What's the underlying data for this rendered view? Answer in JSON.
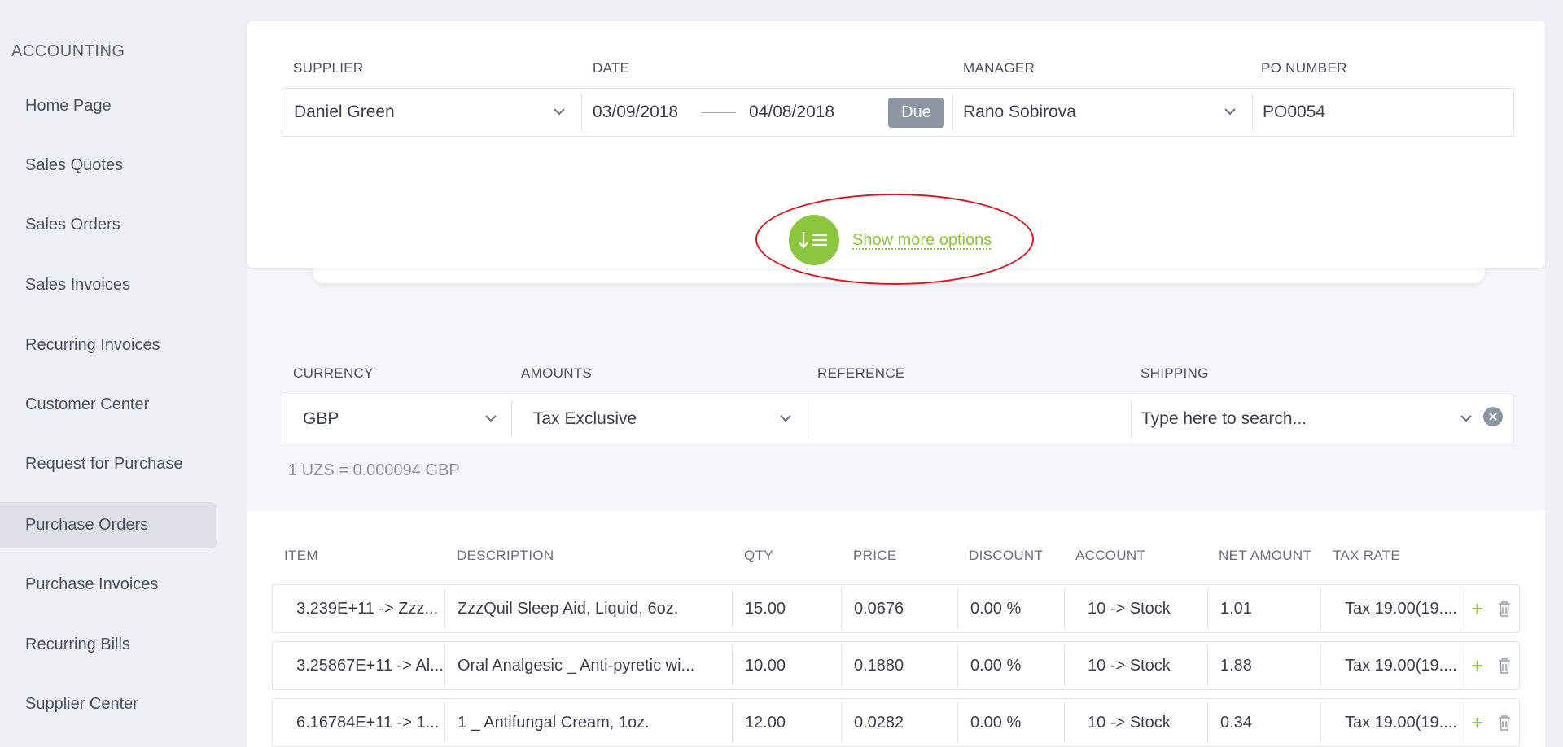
{
  "sidebar": {
    "title": "ACCOUNTING",
    "items": [
      {
        "label": "Home Page",
        "active": false
      },
      {
        "label": "Sales Quotes",
        "active": false
      },
      {
        "label": "Sales Orders",
        "active": false
      },
      {
        "label": "Sales Invoices",
        "active": false
      },
      {
        "label": "Recurring Invoices",
        "active": false
      },
      {
        "label": "Customer Center",
        "active": false
      },
      {
        "label": "Request for Purchase",
        "active": false
      },
      {
        "label": "Purchase Orders",
        "active": true
      },
      {
        "label": "Purchase Invoices",
        "active": false
      },
      {
        "label": "Recurring Bills",
        "active": false
      },
      {
        "label": "Supplier Center",
        "active": false
      }
    ]
  },
  "form": {
    "supplier_label": "SUPPLIER",
    "supplier_value": "Daniel Green",
    "date_label": "DATE",
    "date_from": "03/09/2018",
    "date_to": "04/08/2018",
    "due_label": "Due",
    "manager_label": "MANAGER",
    "manager_value": "Rano Sobirova",
    "po_label": "PO NUMBER",
    "po_value": "PO0054",
    "show_more_label": "Show more options"
  },
  "options": {
    "currency_label": "CURRENCY",
    "currency_value": "GBP",
    "amounts_label": "AMOUNTS",
    "amounts_value": "Tax Exclusive",
    "reference_label": "REFERENCE",
    "reference_value": "",
    "shipping_label": "SHIPPING",
    "shipping_placeholder": "Type here to search...",
    "exchange_rate": "1 UZS = 0.000094 GBP"
  },
  "table": {
    "headers": {
      "item": "ITEM",
      "description": "DESCRIPTION",
      "qty": "QTY",
      "price": "PRICE",
      "discount": "DISCOUNT",
      "account": "ACCOUNT",
      "net_amount": "NET AMOUNT",
      "tax_rate": "TAX RATE"
    },
    "rows": [
      {
        "item": "3.239E+11 -> Zzz...",
        "description": "ZzzQuil Sleep Aid, Liquid, 6oz.",
        "qty": "15.00",
        "price": "0.0676",
        "discount": "0.00 %",
        "account": "10 -> Stock",
        "net_amount": "1.01",
        "tax_rate": "Tax 19.00(19...."
      },
      {
        "item": "3.25867E+11 -> Al...",
        "description": "Oral Analgesic _ Anti-pyretic wi...",
        "qty": "10.00",
        "price": "0.1880",
        "discount": "0.00 %",
        "account": "10 -> Stock",
        "net_amount": "1.88",
        "tax_rate": "Tax 19.00(19...."
      },
      {
        "item": "6.16784E+11 -> 1...",
        "description": "1 _ Antifungal Cream, 1oz.",
        "qty": "12.00",
        "price": "0.0282",
        "discount": "0.00 %",
        "account": "10 -> Stock",
        "net_amount": "0.34",
        "tax_rate": "Tax 19.00(19...."
      }
    ]
  },
  "icons": {
    "chevron": "chevron-down-icon",
    "clear": "clear-circle-icon",
    "sort": "sort-list-icon",
    "add": "plus-icon",
    "delete": "trash-icon"
  },
  "colors": {
    "accent": "#8cc63f",
    "highlight": "#e0141e",
    "badge": "#8c96a3"
  }
}
